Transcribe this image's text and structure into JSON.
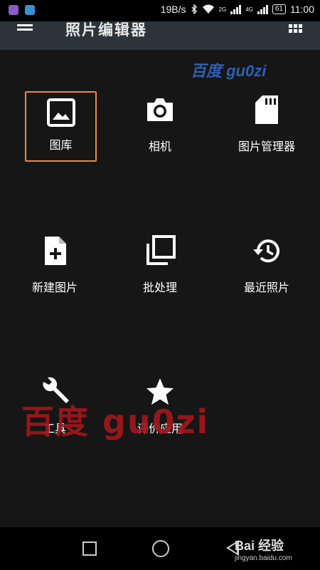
{
  "status_bar": {
    "speed": "19B/s",
    "net_2g": "2G",
    "net_4g": "4G",
    "battery": "61",
    "time": "11:00"
  },
  "app": {
    "title": "照片编辑器"
  },
  "items": [
    {
      "label": "图库",
      "icon": "gallery-icon"
    },
    {
      "label": "相机",
      "icon": "camera-icon"
    },
    {
      "label": "图片管理器",
      "icon": "sd-card-icon"
    },
    {
      "label": "新建图片",
      "icon": "new-file-icon"
    },
    {
      "label": "批处理",
      "icon": "batch-icon"
    },
    {
      "label": "最近照片",
      "icon": "history-icon"
    },
    {
      "label": "工具",
      "icon": "wrench-icon"
    },
    {
      "label": "评价应用",
      "icon": "star-icon"
    }
  ],
  "watermark": {
    "small": "百度 gu0zi",
    "big": "百度  gu0zi"
  },
  "footer": {
    "logo": "Bai 经验",
    "url": "jingyan.baidu.com"
  },
  "colors": {
    "selection": "#f0883a",
    "appbar": "#2c343a",
    "background": "#161616"
  }
}
